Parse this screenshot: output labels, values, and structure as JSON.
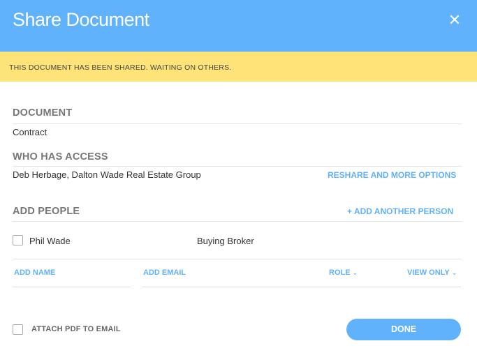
{
  "header": {
    "title": "Share Document",
    "close_glyph": "✕",
    "close_icon": "close-icon",
    "background": "#5fb2fb"
  },
  "banner": {
    "message": "THIS DOCUMENT HAS BEEN SHARED. WAITING ON OTHERS.",
    "background": "#fde378"
  },
  "document": {
    "label": "DOCUMENT",
    "name": "Contract"
  },
  "access": {
    "label": "WHO HAS ACCESS",
    "people": "Deb Herbage, Dalton Wade Real Estate Group",
    "reshare_link": "RESHARE AND MORE OPTIONS"
  },
  "add_people": {
    "label": "ADD PEOPLE",
    "add_another": "+ ADD ANOTHER PERSON",
    "existing": [
      {
        "name": "Phil Wade",
        "role": "Buying Broker",
        "checked": false
      }
    ],
    "new_row": {
      "name_placeholder": "ADD NAME",
      "email_placeholder": "ADD EMAIL",
      "role_label": "ROLE",
      "permission_label": "VIEW ONLY",
      "chevron": "⌄"
    }
  },
  "footer": {
    "attach_pdf_label": "ATTACH PDF TO EMAIL",
    "attach_checked": false,
    "done_label": "DONE"
  },
  "accent_color": "#5fb2fb"
}
